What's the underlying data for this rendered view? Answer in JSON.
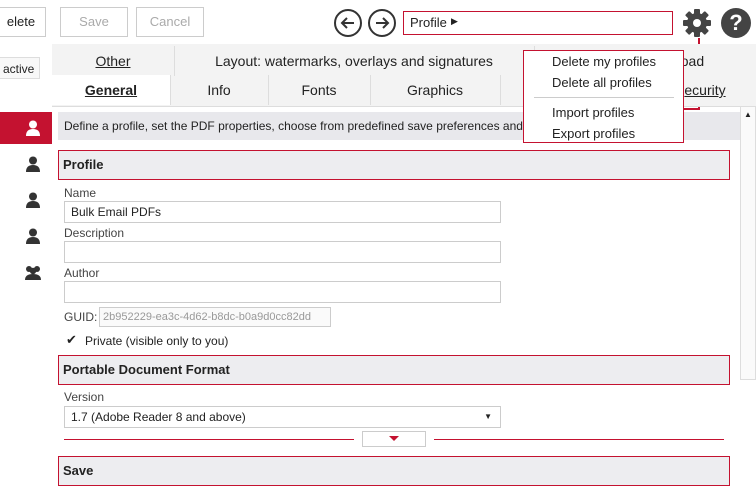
{
  "toolbar": {
    "delete_label": "elete",
    "save_label": "Save",
    "cancel_label": "Cancel",
    "breadcrumb": "Profile",
    "breadcrumb_arrow": "▶"
  },
  "sidebar": {
    "status": "active"
  },
  "tabs": {
    "row1": [
      "Other",
      "Layout: watermarks, overlays and signatures",
      "oload"
    ],
    "row2": [
      "General",
      "Info",
      "Fonts",
      "Graphics",
      "ecurity"
    ]
  },
  "main": {
    "description": "Define a profile, set the PDF properties, choose from predefined save preferences and o"
  },
  "profile": {
    "title": "Profile",
    "name_label": "Name",
    "name_value": "Bulk Email PDFs",
    "description_label": "Description",
    "description_value": "",
    "author_label": "Author",
    "author_value": "",
    "guid_label": "GUID:",
    "guid_value": "2b952229-ea3c-4d62-b8dc-b0a9d0cc82dd",
    "private_label": "Private (visible only to you)",
    "private_checked": true
  },
  "pdf": {
    "title": "Portable Document Format",
    "version_label": "Version",
    "version_value": "1.7 (Adobe Reader 8 and above)"
  },
  "save_section": {
    "title": "Save"
  },
  "menu": {
    "items": [
      "Delete my profiles",
      "Delete all profiles",
      "Import profiles",
      "Export profiles"
    ]
  },
  "colors": {
    "accent": "#c41230"
  }
}
